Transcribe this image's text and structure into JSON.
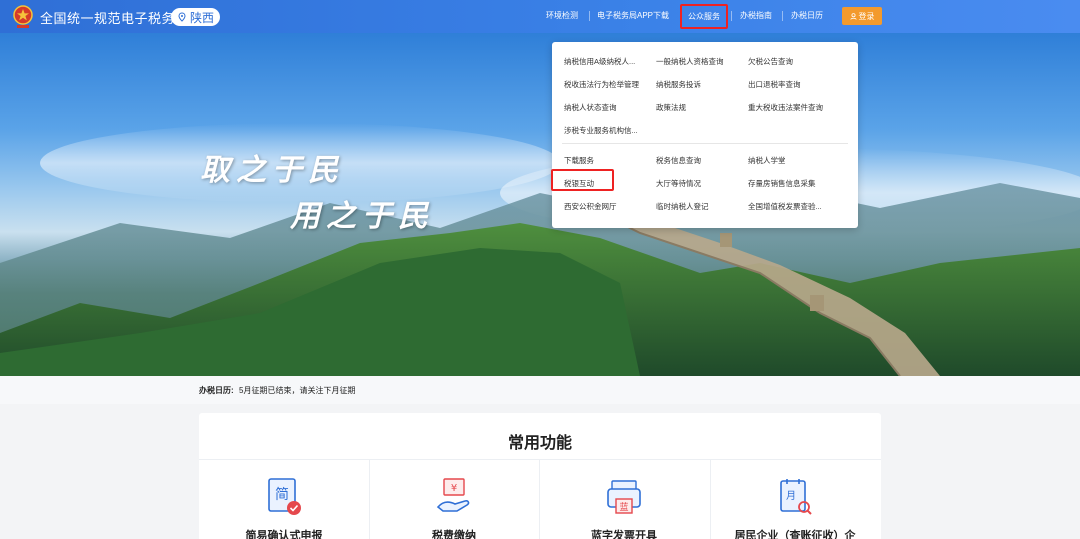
{
  "header": {
    "site_title": "全国统一规范电子税务局",
    "region": "陕西",
    "nav": [
      {
        "label": "环境检测"
      },
      {
        "label": "电子税务局APP下载"
      },
      {
        "label": "公众服务"
      },
      {
        "label": "办税指南"
      },
      {
        "label": "办税日历"
      }
    ],
    "login_label": "登录"
  },
  "hero": {
    "slogan_line1": "取之于民",
    "slogan_line2": "用之于民"
  },
  "dropdown": {
    "group1": [
      "纳税信用A级纳税人...",
      "一般纳税人资格查询",
      "欠税公告查询",
      "税收违法行为检举管理",
      "纳税服务投诉",
      "出口退税率查询",
      "纳税人状态查询",
      "政策法规",
      "重大税收违法案件查询",
      "涉税专业服务机构信..."
    ],
    "group2": [
      "下载服务",
      "税务信息查询",
      "纳税人学堂",
      "税银互动",
      "大厅等待情况",
      "存量房销售信息采集",
      "西安公积金网厅",
      "临时纳税人登记",
      "全国增值税发票查验..."
    ]
  },
  "calendar": {
    "label": "办税日历:",
    "text": "5月征期已结束，请关注下月征期"
  },
  "functions": {
    "title": "常用功能",
    "items": [
      {
        "label": "简易确认式申报",
        "icon": "simple-declaration-icon"
      },
      {
        "label": "税费缴纳",
        "icon": "tax-payment-icon"
      },
      {
        "label": "蓝字发票开具",
        "icon": "invoice-issue-icon"
      },
      {
        "label": "居民企业（查账征收）企",
        "icon": "enterprise-audit-icon"
      }
    ]
  },
  "colors": {
    "header_blue": "#2f6fd6",
    "login_orange": "#f39a2c",
    "highlight_red": "#e22"
  }
}
